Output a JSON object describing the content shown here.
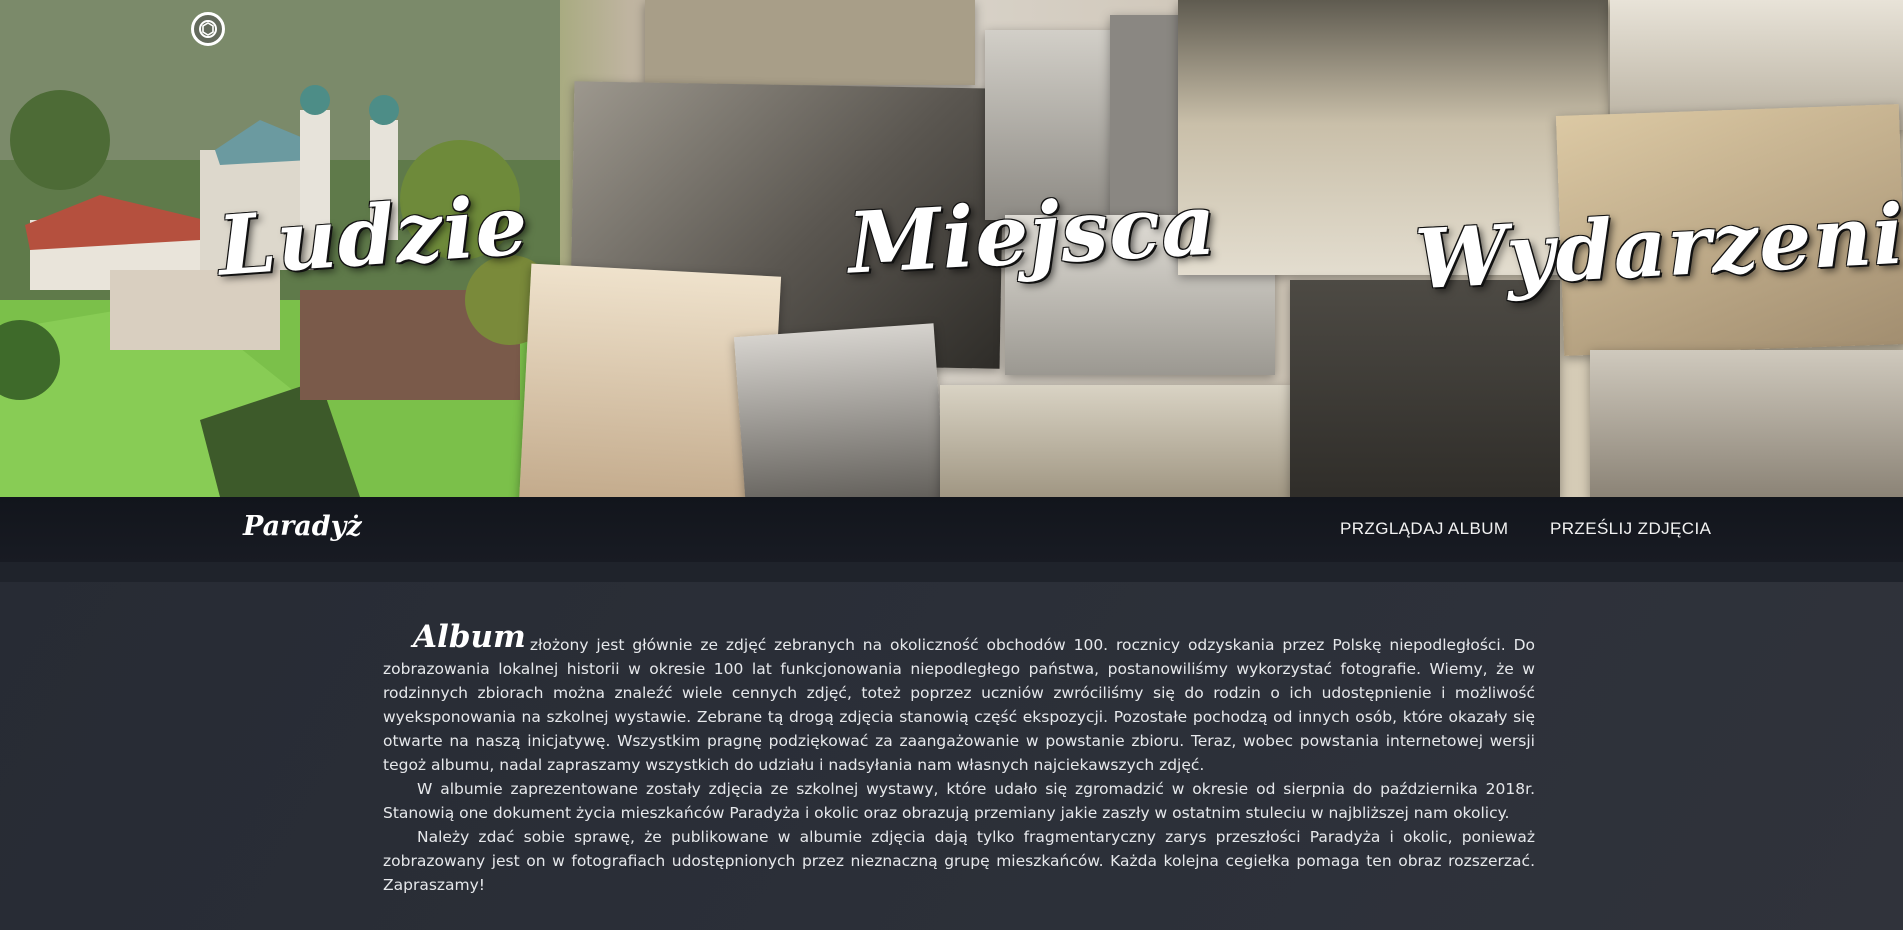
{
  "hero": {
    "words": [
      "Ludzie",
      "Miejsca",
      "Wydarzenia"
    ]
  },
  "navbar": {
    "brand": "Paradyż",
    "links": [
      "PRZGLĄDAJ ALBUM",
      "PRZEŚLIJ ZDJĘCIA"
    ]
  },
  "article": {
    "lead_word": "Album",
    "p1": "złożony jest głównie ze zdjęć zebranych na okoliczność obchodów 100. rocznicy odzyskania  przez Polskę niepodległości. Do zobrazowania lokalnej historii w okresie 100 lat funkcjonowania niepodległego państwa, postanowiliśmy wykorzystać fotografie.  Wiemy, że w rodzinnych zbiorach można znaleźć wiele cennych zdjęć, toteż poprzez uczniów zwróciliśmy się do rodzin o ich udostępnienie i możliwość wyeksponowania na szkolnej wystawie. Zebrane tą drogą zdjęcia stanowią część ekspozycji. Pozostałe pochodzą od innych osób, które okazały się otwarte na naszą inicjatywę. Wszystkim pragnę podziękować za zaangażowanie w powstanie zbioru. Teraz, wobec powstania internetowej wersji tegoż albumu, nadal zapraszamy wszystkich do udziału i nadsyłania nam własnych najciekawszych zdjęć.",
    "p2": "W albumie zaprezentowane zostały zdjęcia ze szkolnej wystawy, które udało się zgromadzić w okresie od sierpnia do października 2018r. Stanowią one dokument życia mieszkańców Paradyża i okolic oraz obrazują przemiany jakie zaszły w ostatnim stuleciu w najbliższej nam okolicy.",
    "p3": "Należy zdać sobie sprawę, że publikowane w albumie zdjęcia dają tylko fragmentaryczny zarys przeszłości Paradyża i okolic, ponieważ zobrazowany jest on w fotografiach udostępnionych przez nieznaczną grupę mieszkańców. Każda kolejna cegiełka pomaga ten obraz rozszerzać. Zapraszamy!"
  },
  "icons": {
    "logo": "camera-lens-icon"
  },
  "colors": {
    "navbar_bg": "#14171e",
    "content_bg": "#2a2e37",
    "text": "#e6e8eb"
  }
}
